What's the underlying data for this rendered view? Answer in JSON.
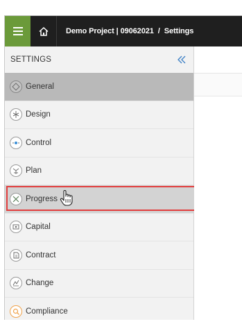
{
  "header": {
    "menu_icon": "hamburger-icon",
    "home_icon": "home-icon",
    "project": "Demo Project | 09062021",
    "separator": "/",
    "page": "Settings"
  },
  "sidebar": {
    "title": "SETTINGS",
    "collapse_icon": "double-chevron-left-icon",
    "items": [
      {
        "label": "General",
        "icon": "general-icon",
        "state": "active"
      },
      {
        "label": "Design",
        "icon": "design-icon"
      },
      {
        "label": "Control",
        "icon": "control-icon"
      },
      {
        "label": "Plan",
        "icon": "plan-icon"
      },
      {
        "label": "Progress",
        "icon": "progress-icon",
        "state": "hover"
      },
      {
        "label": "Capital",
        "icon": "capital-icon"
      },
      {
        "label": "Contract",
        "icon": "contract-icon"
      },
      {
        "label": "Change",
        "icon": "change-icon"
      },
      {
        "label": "Compliance",
        "icon": "compliance-icon"
      }
    ]
  },
  "colors": {
    "topbar": "#1f1f1f",
    "menu_button": "#6b9a3a",
    "active_item": "#b9b9b9",
    "highlight_border": "#e23d3d",
    "compliance_icon": "#f0a24a"
  }
}
